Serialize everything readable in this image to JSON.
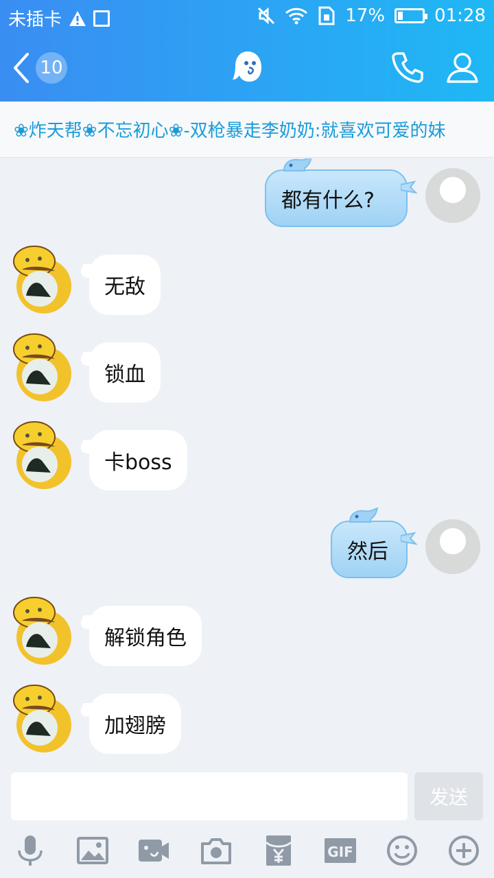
{
  "status_bar": {
    "carrier": "未插卡",
    "battery": "17%",
    "time": "01:28"
  },
  "title_bar": {
    "unread_count": "10"
  },
  "announcement": {
    "text": "❀炸天帮❀不忘初心❀-双枪暴走李奶奶:就喜欢可爱的妹"
  },
  "messages": [
    {
      "side": "right",
      "text": "都有什么?"
    },
    {
      "side": "left",
      "text": "无敌"
    },
    {
      "side": "left",
      "text": "锁血"
    },
    {
      "side": "left",
      "text": "卡boss"
    },
    {
      "side": "right",
      "text": "然后"
    },
    {
      "side": "left",
      "text": "解锁角色"
    },
    {
      "side": "left",
      "text": "加翅膀"
    }
  ],
  "input_bar": {
    "send_label": "发送"
  },
  "colors": {
    "header_start": "#3a8df2",
    "header_end": "#1fb8f5",
    "announce_text": "#1b9bd8",
    "bubble_right": "#a8d6f6",
    "toolbar_icon": "#8f9aa6"
  },
  "toolbar_icons": [
    "microphone-icon",
    "image-icon",
    "video-call-icon",
    "camera-icon",
    "red-packet-icon",
    "gif-icon",
    "emoji-icon",
    "plus-icon"
  ]
}
